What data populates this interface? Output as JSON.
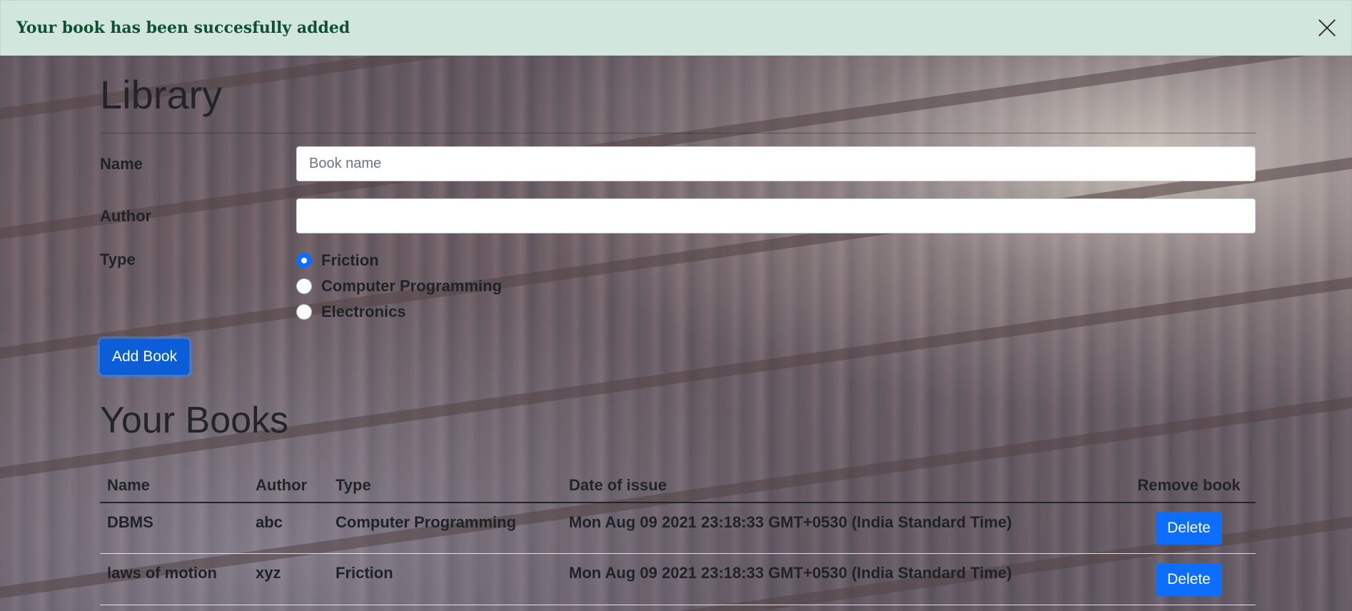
{
  "alert": {
    "message": "Your book has been succesfully added",
    "close_icon": "close-icon"
  },
  "form": {
    "title": "Library",
    "name_label": "Name",
    "name_placeholder": "Book name",
    "name_value": "",
    "author_label": "Author",
    "author_value": "",
    "type_label": "Type",
    "types": [
      {
        "label": "Friction",
        "checked": true
      },
      {
        "label": "Computer Programming",
        "checked": false
      },
      {
        "label": "Electronics",
        "checked": false
      }
    ],
    "submit_label": "Add Book"
  },
  "books": {
    "title": "Your Books",
    "columns": [
      "Name",
      "Author",
      "Type",
      "Date of issue",
      "Remove book"
    ],
    "rows": [
      {
        "name": "DBMS",
        "author": "abc",
        "type": "Computer Programming",
        "date": "Mon Aug 09 2021 23:18:33 GMT+0530 (India Standard Time)",
        "action": "Delete"
      },
      {
        "name": "laws of motion",
        "author": "xyz",
        "type": "Friction",
        "date": "Mon Aug 09 2021 23:18:33 GMT+0530 (India Standard Time)",
        "action": "Delete"
      }
    ]
  },
  "colors": {
    "alert_bg": "#d1e7dd",
    "alert_text": "#0f5132",
    "primary": "#0d6efd"
  }
}
